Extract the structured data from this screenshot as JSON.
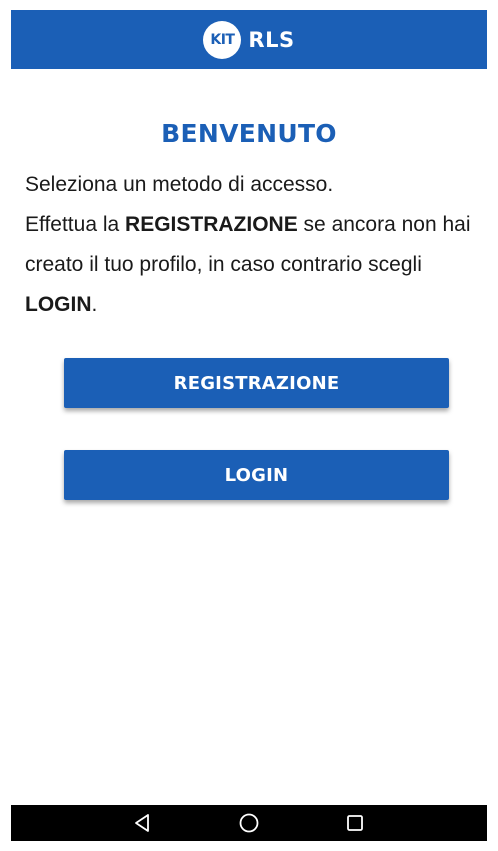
{
  "header": {
    "logo_badge": "KIT",
    "logo_text": "RLS"
  },
  "main": {
    "title": "BENVENUTO",
    "intro": {
      "line1": "Seleziona un metodo di accesso.",
      "part1": "Effettua la ",
      "bold1": "REGISTRAZIONE",
      "part2": " se ancora non hai creato il tuo profilo, in caso contrario scegli ",
      "bold2": "LOGIN",
      "part3": "."
    },
    "register_label": "REGISTRAZIONE",
    "login_label": "LOGIN"
  },
  "colors": {
    "brand": "#1b5fb6",
    "text": "#1a1a1a",
    "navbar": "#000000"
  },
  "navbar": {
    "icons": [
      "back-icon",
      "home-icon",
      "recents-icon"
    ]
  }
}
